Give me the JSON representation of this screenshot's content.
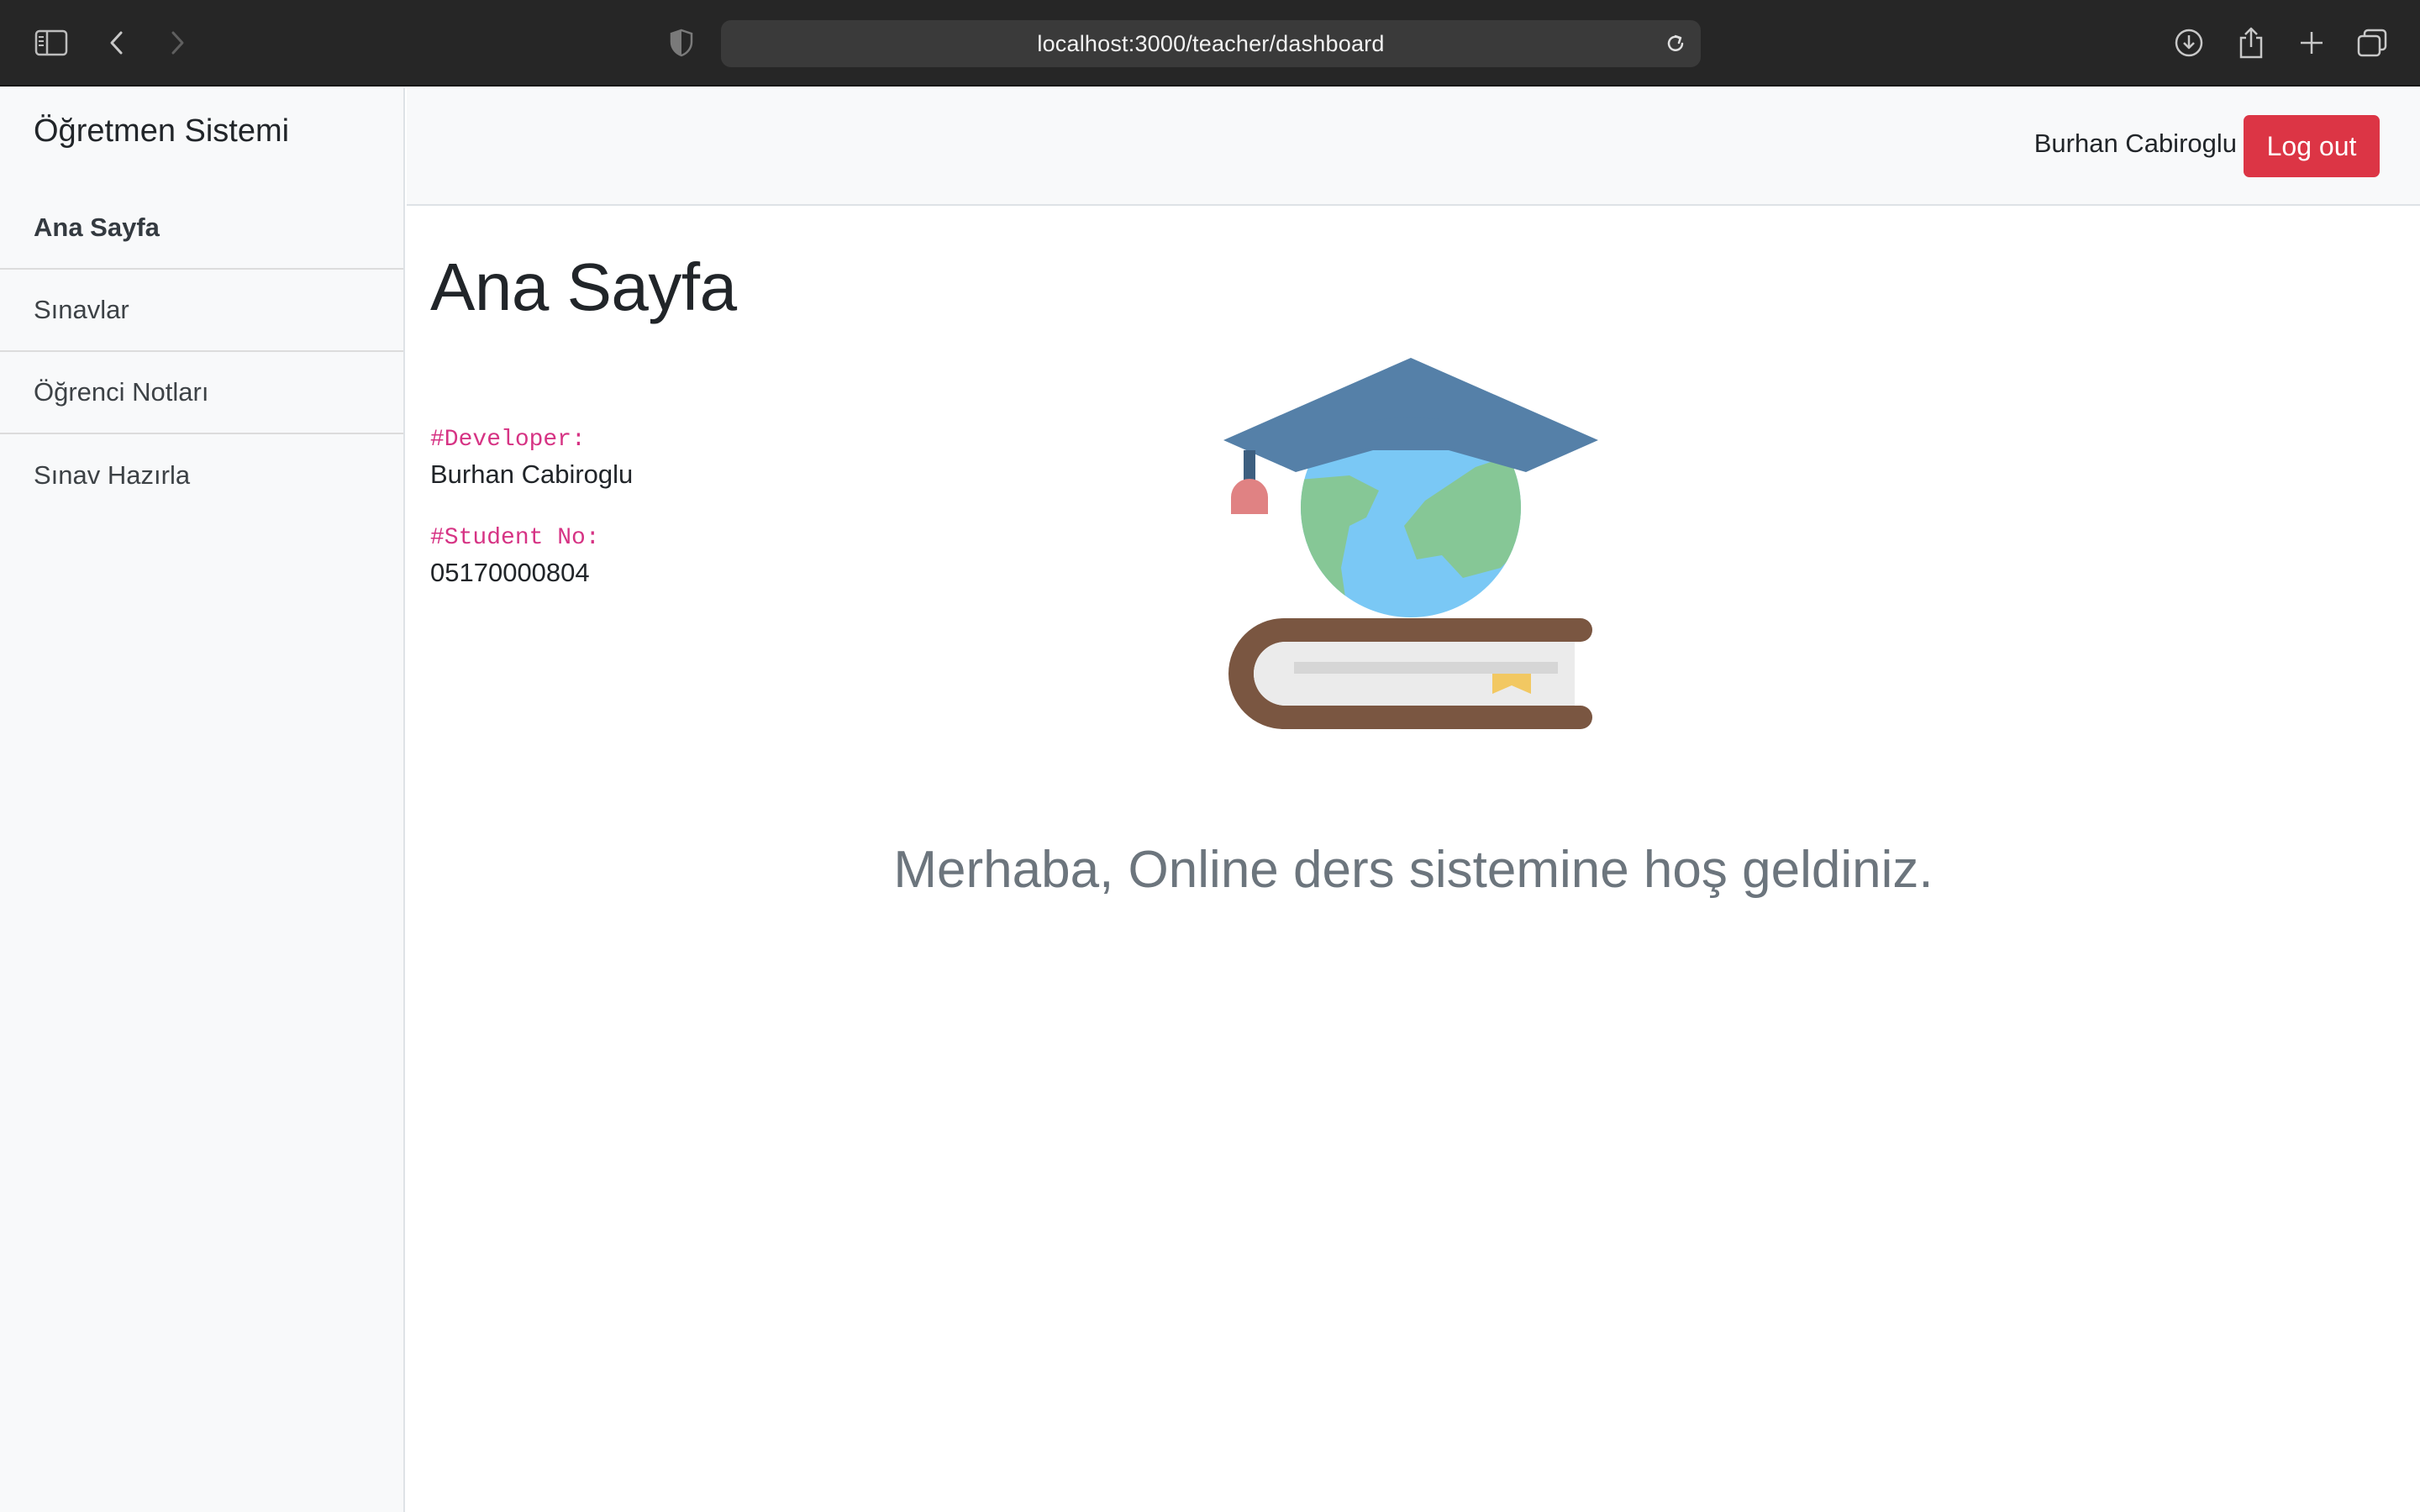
{
  "browser": {
    "url": "localhost:3000/teacher/dashboard"
  },
  "sidebar": {
    "brand": "Öğretmen Sistemi",
    "items": [
      {
        "label": "Ana Sayfa",
        "active": true
      },
      {
        "label": "Sınavlar",
        "active": false
      },
      {
        "label": "Öğrenci Notları",
        "active": false
      },
      {
        "label": "Sınav Hazırla",
        "active": false
      }
    ]
  },
  "header": {
    "user_name": "Burhan Cabiroglu",
    "logout_label": "Log out"
  },
  "main": {
    "title": "Ana Sayfa",
    "developer_label": "#Developer:",
    "developer_name": "Burhan Cabiroglu",
    "student_no_label": "#Student No:",
    "student_no": "05170000804",
    "welcome": "Merhaba, Online ders sistemine hoş geldiniz."
  },
  "icons": {
    "sidebar_toggle": "sidebar-icon",
    "back": "chevron-left-icon",
    "forward": "chevron-right-icon",
    "privacy": "shield-icon",
    "reload": "reload-icon",
    "downloads": "download-icon",
    "share": "share-icon",
    "new_tab": "plus-icon",
    "tabs": "tabs-overview-icon",
    "illustration": "graduation-globe-book-illustration"
  },
  "colors": {
    "logout": "#dc3545",
    "code_label": "#d63384",
    "welcome_text": "#6c757d",
    "cap": "#5580a8",
    "globe_water": "#7ac8f5",
    "globe_land": "#86c796",
    "book_cover": "#7a5641",
    "tassel": "#e08283",
    "bookmark": "#f2c862"
  }
}
